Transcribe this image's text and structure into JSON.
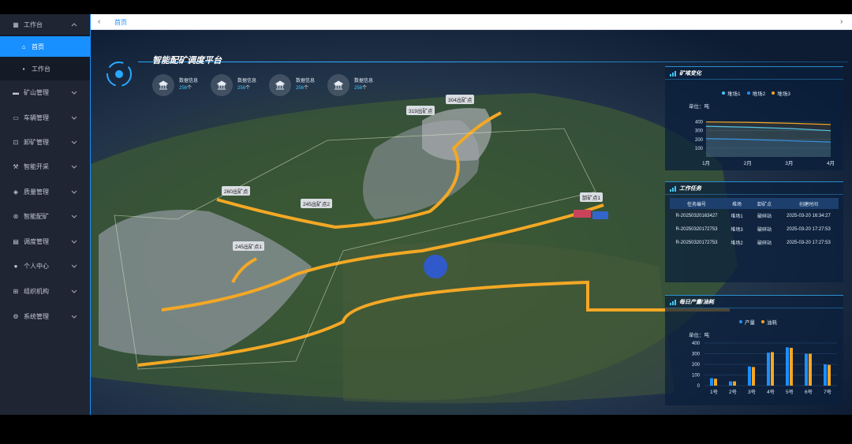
{
  "sidebar": {
    "items": [
      {
        "label": "工作台",
        "icon": "dashboard-icon",
        "expanded": true
      },
      {
        "label": "首页",
        "icon": "home-icon",
        "active": true
      },
      {
        "label": "工作台",
        "icon": "grid-icon"
      },
      {
        "label": "矿山管理",
        "icon": "monitor-icon"
      },
      {
        "label": "车辆管理",
        "icon": "truck-icon"
      },
      {
        "label": "卸矿管理",
        "icon": "unload-icon"
      },
      {
        "label": "智能开采",
        "icon": "pickaxe-icon"
      },
      {
        "label": "质量管理",
        "icon": "shield-icon"
      },
      {
        "label": "智能配矿",
        "icon": "blend-icon"
      },
      {
        "label": "调度管理",
        "icon": "schedule-icon"
      },
      {
        "label": "个人中心",
        "icon": "user-icon"
      },
      {
        "label": "组织机构",
        "icon": "org-icon"
      },
      {
        "label": "系统管理",
        "icon": "gear-icon"
      }
    ]
  },
  "topnav": {
    "tab": "首页"
  },
  "dashboard": {
    "title": "智能配矿调度平台",
    "stats": [
      {
        "label": "数据信息",
        "value": "256",
        "unit": "个"
      },
      {
        "label": "数据信息",
        "value": "256",
        "unit": "个"
      },
      {
        "label": "数据信息",
        "value": "256",
        "unit": "个"
      },
      {
        "label": "数据信息",
        "value": "256",
        "unit": "个"
      }
    ],
    "map_labels": [
      "304出矿点",
      "319出矿点",
      "260出矿点",
      "245出矿点2",
      "245出矿点1",
      "卸矿点1"
    ]
  },
  "panel1": {
    "title": "矿堆变化",
    "legend": [
      "堆场1",
      "堆场2",
      "堆场3"
    ],
    "unit": "单位：吨",
    "yticks": [
      "400",
      "300",
      "200",
      "100"
    ],
    "xticks": [
      "1月",
      "2月",
      "3月",
      "4月"
    ]
  },
  "panel2": {
    "title": "工作任务",
    "headers": [
      "任务编号",
      "堆场",
      "卸矿点",
      "创建时间"
    ],
    "rows": [
      [
        "R-20250320163427",
        "堆场1",
        "破碎站",
        "2025-03-20 16:34:27"
      ],
      [
        "R-20250320172753",
        "堆场3",
        "破碎站",
        "2025-03-20 17:27:53"
      ],
      [
        "R-20250320172753",
        "堆场2",
        "破碎站",
        "2025-03-20 17:27:53"
      ]
    ]
  },
  "panel3": {
    "title": "每日产量/油耗",
    "legend": [
      "产量",
      "油耗"
    ],
    "unit": "单位：吨",
    "yticks": [
      "400",
      "300",
      "200",
      "100",
      "0"
    ]
  },
  "colors": {
    "accent": "#1890ff",
    "series1": "#1f8fff",
    "series2": "#f5a623",
    "series3": "#3fc8ff"
  },
  "chart_data": [
    {
      "type": "area",
      "title": "矿堆变化",
      "ylabel": "单位：吨",
      "categories": [
        "1月",
        "2月",
        "3月",
        "4月"
      ],
      "series": [
        {
          "name": "堆场1",
          "values": [
            350,
            340,
            325,
            300
          ]
        },
        {
          "name": "堆场2",
          "values": [
            210,
            200,
            185,
            170
          ]
        },
        {
          "name": "堆场3",
          "values": [
            400,
            395,
            385,
            370
          ]
        }
      ],
      "ylim": [
        0,
        450
      ]
    },
    {
      "type": "bar",
      "title": "每日产量/油耗",
      "ylabel": "单位：吨",
      "categories": [
        "1号",
        "2号",
        "3号",
        "4号",
        "5号",
        "6号",
        "7号"
      ],
      "series": [
        {
          "name": "产量",
          "values": [
            70,
            40,
            180,
            310,
            360,
            300,
            200
          ]
        },
        {
          "name": "油耗",
          "values": [
            65,
            40,
            175,
            315,
            355,
            300,
            195
          ]
        }
      ],
      "ylim": [
        0,
        400
      ]
    }
  ]
}
